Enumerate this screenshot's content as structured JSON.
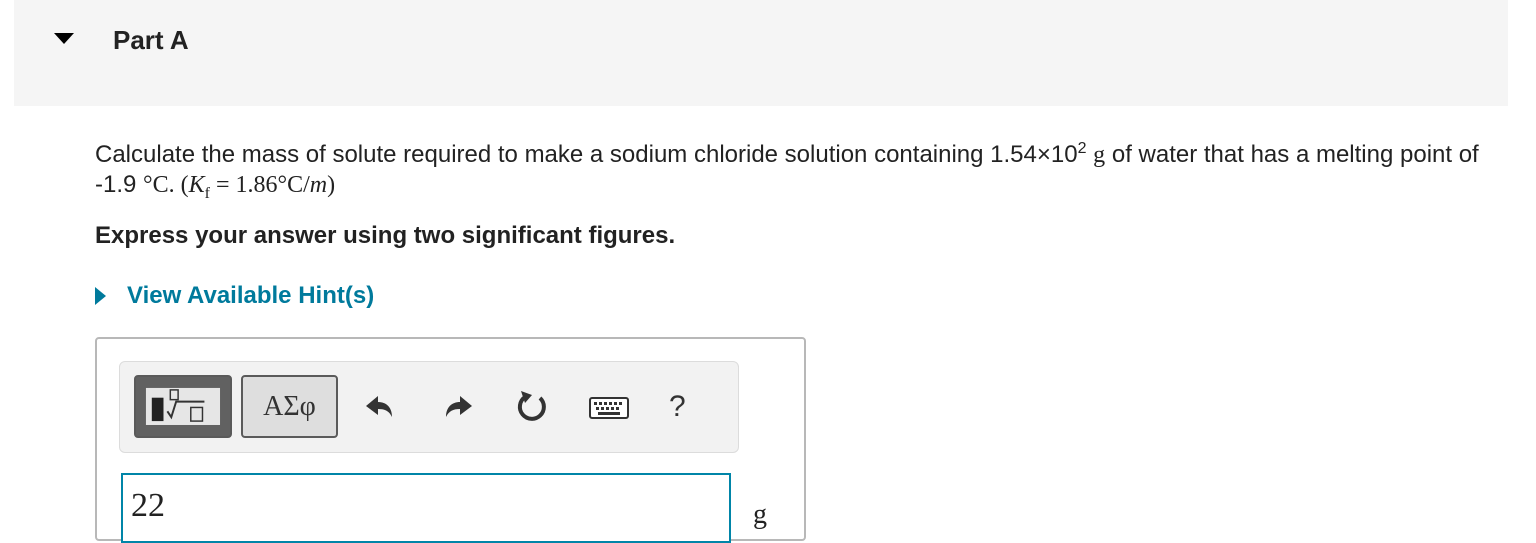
{
  "part": {
    "title": "Part A"
  },
  "question": {
    "text_before": "Calculate the mass of solute required to make a sodium chloride solution containing 1.54×10",
    "exponent": "2",
    "mass_unit": "g",
    "text_after": " of water that has a melting point of -1.9",
    "temp_unit": "°C",
    "kf_open": ". (",
    "kf_symbol": "K",
    "kf_subscript": "f",
    "kf_value": " = 1.86°C/",
    "kf_m": "m",
    "kf_close": ")"
  },
  "instruction": "Express your answer using two significant figures.",
  "hint_link": "View Available Hint(s)",
  "toolbar": {
    "symbols_label": "ΑΣφ",
    "help_label": "?",
    "icons": [
      "templates-icon",
      "undo-icon",
      "redo-icon",
      "reset-icon",
      "keyboard-icon",
      "help-icon"
    ]
  },
  "answer": {
    "value": "22",
    "unit": "g"
  }
}
